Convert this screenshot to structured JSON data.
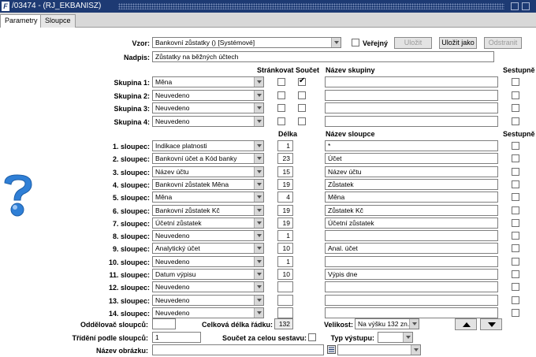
{
  "window": {
    "title": "/03474 - (RJ_EKBANISZ)"
  },
  "tabs": [
    {
      "label": "Parametry"
    },
    {
      "label": "Sloupce"
    }
  ],
  "form": {
    "vzor": {
      "label": "Vzor:",
      "value": "Bankovní zůstatky  ()  [Systémové]"
    },
    "verejny": {
      "label": "Veřejný",
      "checked": false
    },
    "buttons": {
      "ulozit": "Uložit",
      "ulozit_jako": "Uložit jako",
      "odstranit": "Odstranit"
    },
    "nadpis": {
      "label": "Nadpis:",
      "value": "Zůstatky na běžných účtech"
    }
  },
  "groups": {
    "headers": {
      "strankovat": "Stránkovat",
      "soucet": "Součet",
      "nazev": "Název skupiny",
      "sestupne": "Sestupně"
    },
    "rows": [
      {
        "label": "Skupina 1:",
        "value": "Měna",
        "strankovat": false,
        "soucet": true,
        "name": "",
        "sestupne": false
      },
      {
        "label": "Skupina 2:",
        "value": "Neuvedeno",
        "strankovat": false,
        "soucet": false,
        "name": "",
        "sestupne": false
      },
      {
        "label": "Skupina 3:",
        "value": "Neuvedeno",
        "strankovat": false,
        "soucet": false,
        "name": "",
        "sestupne": false
      },
      {
        "label": "Skupina 4:",
        "value": "Neuvedeno",
        "strankovat": false,
        "soucet": false,
        "name": "",
        "sestupne": false
      }
    ]
  },
  "columns": {
    "headers": {
      "delka": "Délka",
      "nazev": "Název sloupce",
      "sestupne": "Sestupně"
    },
    "rows": [
      {
        "label": "1. sloupec:",
        "value": "Indikace platnosti",
        "length": "1",
        "name": "*"
      },
      {
        "label": "2. sloupec:",
        "value": "Bankovní účet a Kód banky",
        "length": "23",
        "name": "Účet"
      },
      {
        "label": "3. sloupec:",
        "value": "Název účtu",
        "length": "15",
        "name": "Název účtu"
      },
      {
        "label": "4. sloupec:",
        "value": "Bankovní zůstatek Měna",
        "length": "19",
        "name": "Zůstatek"
      },
      {
        "label": "5. sloupec:",
        "value": "Měna",
        "length": "4",
        "name": "Měna"
      },
      {
        "label": "6. sloupec:",
        "value": "Bankovní zůstatek Kč",
        "length": "19",
        "name": "Zůstatek Kč"
      },
      {
        "label": "7. sloupec:",
        "value": "Účetní zůstatek",
        "length": "19",
        "name": "Účetní zůstatek"
      },
      {
        "label": "8. sloupec:",
        "value": "Neuvedeno",
        "length": "1",
        "name": ""
      },
      {
        "label": "9. sloupec:",
        "value": "Analytický účet",
        "length": "10",
        "name": "Anal. účet"
      },
      {
        "label": "10. sloupec:",
        "value": "Neuvedeno",
        "length": "1",
        "name": ""
      },
      {
        "label": "11. sloupec:",
        "value": "Datum výpisu",
        "length": "10",
        "name": "Výpis dne"
      },
      {
        "label": "12. sloupec:",
        "value": "Neuvedeno",
        "length": "",
        "name": ""
      },
      {
        "label": "13. sloupec:",
        "value": "Neuvedeno",
        "length": "",
        "name": ""
      },
      {
        "label": "14. sloupec:",
        "value": "Neuvedeno",
        "length": "",
        "name": ""
      }
    ]
  },
  "footer": {
    "oddelovac": {
      "label": "Oddělovač sloupců:",
      "value": ""
    },
    "celkova": {
      "label": "Celková délka řádku:",
      "value": "132"
    },
    "velikost": {
      "label": "Velikost:",
      "value": "Na výšku 132 zn."
    },
    "trideni": {
      "label": "Třídění podle sloupců:",
      "value": "1"
    },
    "soucet_sestavy": {
      "label": "Součet za celou sestavu:",
      "checked": false
    },
    "typ_vystupu": {
      "label": "Typ výstupu:",
      "value": ""
    },
    "nazev_obrazku": {
      "label": "Název obrázku:",
      "value": ""
    }
  },
  "colors": {
    "titlebar": "#1d3a73",
    "tabbar": "#d8d8d8",
    "help_icon": "#2f7fd6"
  },
  "icons": [
    "help-question-icon",
    "arrow-up-icon",
    "arrow-down-icon",
    "list-picker-icon"
  ]
}
